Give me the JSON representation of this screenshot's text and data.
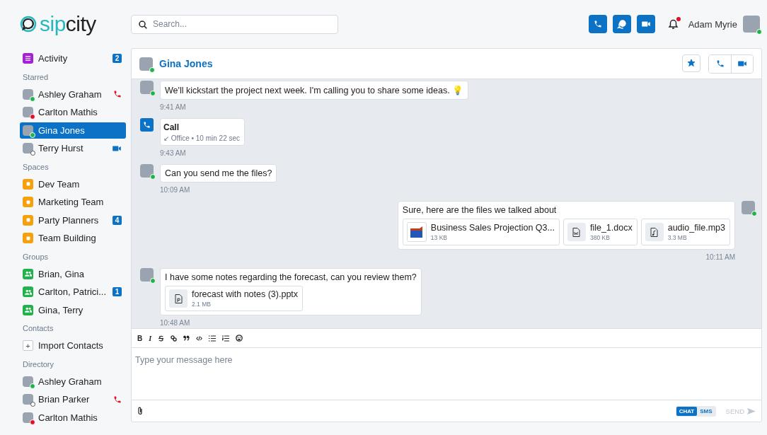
{
  "brand": {
    "name_a": "sip",
    "name_b": "city"
  },
  "search": {
    "placeholder": "Search..."
  },
  "user": {
    "name": "Adam Myrie",
    "color": "#22b24c",
    "notifications": true
  },
  "sidebar": [
    {
      "items": [
        {
          "kind": "activity",
          "label": "Activity",
          "badge": "2",
          "selected": false
        }
      ]
    },
    {
      "heading": "Starred",
      "items": [
        {
          "kind": "contact",
          "label": "Ashley Graham",
          "color": "#22b24c",
          "indicator": {
            "kind": "missed-call"
          },
          "selected": false
        },
        {
          "kind": "contact",
          "label": "Carlton Mathis",
          "color": "#e0102a",
          "selected": false
        },
        {
          "kind": "contact",
          "label": "Gina Jones",
          "color": "#22b24c",
          "selected": true
        },
        {
          "kind": "contact",
          "label": "Terry Hurst",
          "color": "#ffffff",
          "indicator": {
            "kind": "video"
          },
          "selected": false
        }
      ]
    },
    {
      "heading": "Spaces",
      "items": [
        {
          "kind": "space",
          "label": "Dev Team",
          "selected": false
        },
        {
          "kind": "space",
          "label": "Marketing Team",
          "selected": false
        },
        {
          "kind": "space",
          "label": "Party Planners",
          "badge": "4",
          "selected": false
        },
        {
          "kind": "space",
          "label": "Team Building",
          "selected": false
        }
      ]
    },
    {
      "heading": "Groups",
      "items": [
        {
          "kind": "group",
          "label": "Brian, Gina",
          "selected": false
        },
        {
          "kind": "group",
          "label": "Carlton, Patrici...",
          "badge": "1",
          "selected": false
        },
        {
          "kind": "group",
          "label": "Gina, Terry",
          "selected": false
        }
      ]
    },
    {
      "heading": "Contacts",
      "items": [
        {
          "kind": "action",
          "icon": "+",
          "label": "Import Contacts",
          "selected": false
        }
      ]
    },
    {
      "heading": "Directory",
      "items": [
        {
          "kind": "contact",
          "label": "Ashley Graham",
          "color": "#22b24c",
          "selected": false
        },
        {
          "kind": "contact",
          "label": "Brian Parker",
          "color": "#ffffff",
          "indicator": {
            "kind": "missed-call"
          },
          "selected": false
        },
        {
          "kind": "contact",
          "label": "Carlton Mathis",
          "color": "#e0102a",
          "selected": false
        }
      ]
    }
  ],
  "chat": {
    "title": "Gina Jones",
    "color": "#22b24c",
    "starred": true,
    "messages": [
      {
        "kind": "text",
        "outgoing": false,
        "text": "We'll kickstart the project next week. I'm calling you to share some ideas. 💡",
        "time": "9:41 AM"
      },
      {
        "kind": "call",
        "outgoing": false,
        "title": "Call",
        "direction": "↙",
        "detail": "Office • 10 min 22 sec",
        "time": "9:43 AM"
      },
      {
        "kind": "text",
        "outgoing": false,
        "text": "Can you send me the files?",
        "time": "10:09 AM"
      },
      {
        "kind": "text",
        "outgoing": true,
        "text": "Sure, here are the files we talked about",
        "time": "10:11 AM",
        "files": [
          {
            "kind": "chart",
            "name": "Business Sales Projection Q3...",
            "size": "13 KB"
          },
          {
            "kind": "word",
            "name": "file_1.docx",
            "size": "380 KB"
          },
          {
            "kind": "audio",
            "name": "audio_file.mp3",
            "size": "3.3 MB"
          }
        ]
      },
      {
        "kind": "text",
        "outgoing": false,
        "text": "I have some notes regarding the forecast, can you review them?",
        "time": "10:48 AM",
        "files": [
          {
            "kind": "slides",
            "name": "forecast with notes (3).pptx",
            "size": "2.1 MB"
          }
        ]
      }
    ]
  },
  "toolbar": [
    {
      "kind": "bold",
      "label": "B"
    },
    {
      "kind": "italic",
      "label": "I"
    },
    {
      "kind": "strike"
    },
    {
      "kind": "link"
    },
    {
      "kind": "quote"
    },
    {
      "kind": "code"
    },
    {
      "kind": "bullets"
    },
    {
      "kind": "numbers"
    },
    {
      "kind": "emoji"
    }
  ],
  "composer": {
    "placeholder": "Type your message here"
  },
  "modes": [
    {
      "label": "CHAT",
      "selected": true
    },
    {
      "label": "SMS",
      "selected": false
    }
  ],
  "send": {
    "label": "SEND",
    "disabled": true
  }
}
